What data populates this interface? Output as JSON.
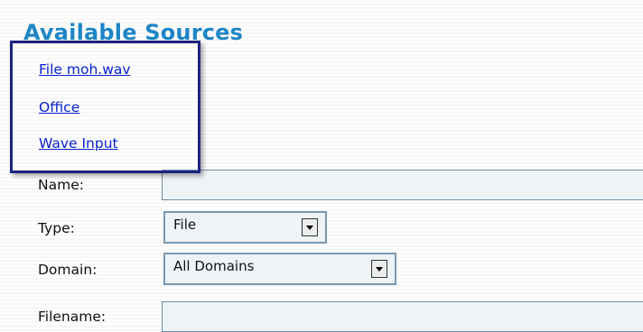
{
  "section": {
    "title": "Available Sources"
  },
  "sources": [
    {
      "label": "File moh.wav"
    },
    {
      "label": "Office"
    },
    {
      "label": "Wave Input"
    }
  ],
  "form": {
    "name": {
      "label": "Name:",
      "value": ""
    },
    "type": {
      "label": "Type:",
      "value": "File"
    },
    "domain": {
      "label": "Domain:",
      "value": "All Domains"
    },
    "filename": {
      "label": "Filename:",
      "value": ""
    }
  },
  "colors": {
    "title": "#1e86c6",
    "link": "#0a22cc",
    "highlight_border": "#1c2480",
    "field_border": "#6f8ea6",
    "field_background": "#eef3f6"
  },
  "icons": {
    "dropdown": "chevron-down-icon"
  }
}
